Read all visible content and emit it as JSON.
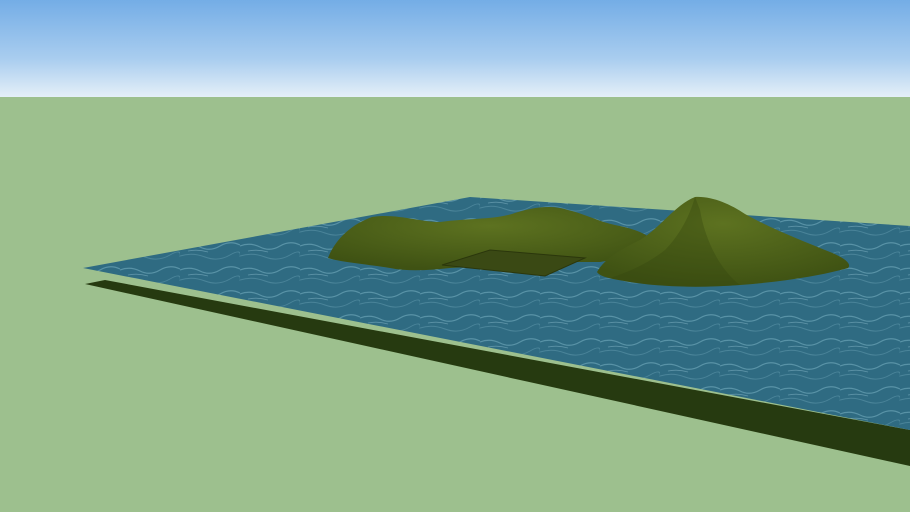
{
  "scene": {
    "colors": {
      "sky_top": "#74ade6",
      "sky_horizon": "#e6f0f8",
      "ground": "#9dc08e",
      "water": "#2e6a80",
      "water_light": "#5e98aa",
      "slab": "#263a10",
      "terrain": "#4a5e1a",
      "terrain_dark": "#34450f",
      "terrain_light": "#61761f",
      "flat_area": "#3e4d16"
    }
  }
}
